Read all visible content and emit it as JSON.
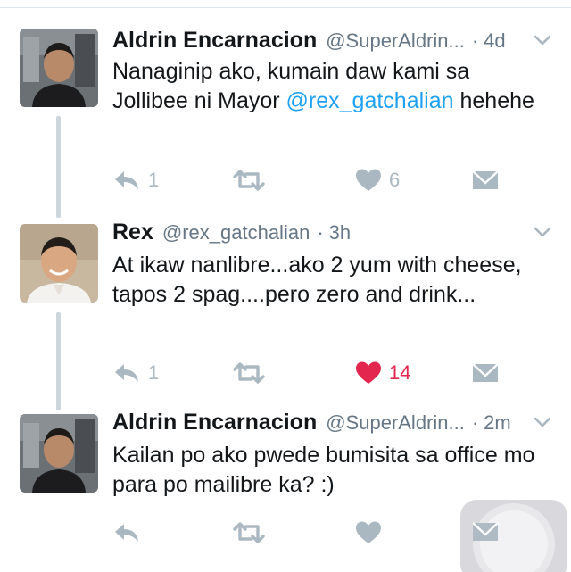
{
  "tweets": [
    {
      "name": "Aldrin Encarnacion",
      "handle": "@SuperAldrin...",
      "sep": "·",
      "time": "4d",
      "text_parts": [
        "Nanaginip ako, kumain daw kami sa Jollibee ni Mayor ",
        "@rex_gatchalian",
        " hehehe"
      ],
      "reply_count": "1",
      "retweet_count": "",
      "like_count": "6",
      "liked": false
    },
    {
      "name": "Rex",
      "handle": "@rex_gatchalian",
      "sep": "·",
      "time": "3h",
      "text": "At ikaw nanlibre...ako 2 yum with cheese, tapos 2 spag....pero zero and drink...",
      "reply_count": "1",
      "retweet_count": "",
      "like_count": "14",
      "liked": true
    },
    {
      "name": "Aldrin Encarnacion",
      "handle": "@SuperAldrin...",
      "sep": "·",
      "time": "2m",
      "text": "Kailan po ako pwede bumisita sa office mo para po mailibre ka? :)",
      "reply_count": "",
      "retweet_count": "",
      "like_count": "",
      "liked": false
    }
  ],
  "colors": {
    "icon_gray": "#aab8c2",
    "like_red": "#e2264d",
    "mention_blue": "#1da1f2",
    "thread_line": "#ccd6dd"
  },
  "icons": [
    "reply-icon",
    "retweet-icon",
    "like-icon",
    "direct-message-icon",
    "chevron-down-icon"
  ]
}
